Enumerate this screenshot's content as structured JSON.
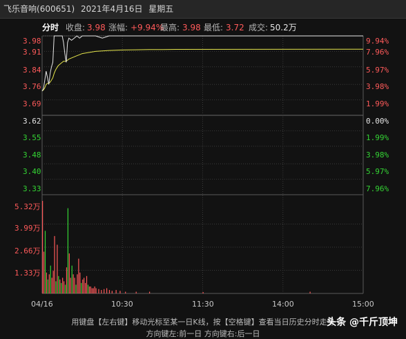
{
  "title": {
    "name": "飞乐音响",
    "code": "(600651)",
    "date": "2021年4月16日",
    "weekday": "星期五"
  },
  "info": {
    "mode": "分时",
    "close_label": "收盘:",
    "close_value": "3.98",
    "change_label": "涨幅:",
    "change_value": "+9.94%",
    "high_label": "最高:",
    "high_value": "3.98",
    "low_label": "最低:",
    "low_value": "3.72",
    "volume_label": "成交:",
    "volume_value": "50.2万"
  },
  "price_axis": {
    "left": [
      "3.98",
      "3.91",
      "3.84",
      "3.76",
      "3.69",
      "3.62",
      "3.55",
      "3.48",
      "3.40",
      "3.33"
    ],
    "right": [
      "9.94%",
      "7.96%",
      "5.97%",
      "3.98%",
      "1.99%",
      "0.00%",
      "1.99%",
      "3.98%",
      "5.97%",
      "7.96%"
    ]
  },
  "volume_axis": {
    "labels": [
      "5.32万",
      "3.99万",
      "2.66万",
      "1.33万"
    ]
  },
  "time_axis": [
    "04/16",
    "10:30",
    "11:30",
    "14:00",
    "15:00"
  ],
  "footer": {
    "line1": "用键盘【左右键】移动光标至某一日K线，按【空格键】查看当日历史分时走势",
    "line2": "方向键左:前一日   方向键右:后一日"
  },
  "watermark": "头条 @千斤顶坤",
  "colors": {
    "up": "#ff5a5a",
    "down": "#34d534",
    "price_line": "#e8e8e8",
    "avg_line": "#e6e64c",
    "grid": "#3a3a3a"
  },
  "chart_data": {
    "type": "line",
    "prev_close": 3.62,
    "ylim": [
      3.26,
      3.98
    ],
    "x": [
      0,
      1,
      2,
      3,
      4,
      5,
      6,
      7,
      8,
      9,
      10,
      11,
      12,
      13,
      14,
      15,
      16,
      17,
      18,
      19,
      20,
      22,
      24,
      26,
      28,
      30,
      35,
      40,
      45,
      50,
      60,
      70,
      80,
      90,
      100,
      240
    ],
    "series": [
      {
        "values": [
          3.73,
          3.74,
          3.78,
          3.82,
          3.79,
          3.76,
          3.81,
          3.84,
          3.86,
          3.98,
          3.98,
          3.98,
          3.98,
          3.98,
          3.98,
          3.98,
          3.95,
          3.9,
          3.86,
          3.95,
          3.97,
          3.96,
          3.97,
          3.98,
          3.97,
          3.98,
          3.98,
          3.98,
          3.97,
          3.98,
          3.98,
          3.98,
          3.98,
          3.98,
          3.98,
          3.98
        ]
      },
      {
        "values": [
          3.73,
          3.735,
          3.745,
          3.76,
          3.765,
          3.765,
          3.77,
          3.78,
          3.79,
          3.81,
          3.825,
          3.835,
          3.845,
          3.85,
          3.855,
          3.86,
          3.865,
          3.865,
          3.865,
          3.87,
          3.875,
          3.88,
          3.885,
          3.89,
          3.895,
          3.9,
          3.905,
          3.91,
          3.912,
          3.914,
          3.916,
          3.917,
          3.918,
          3.918,
          3.919,
          3.92
        ]
      }
    ],
    "volume": {
      "ylim": [
        0,
        5.32
      ],
      "bars": [
        [
          0,
          5.32,
          "up"
        ],
        [
          1,
          2.4,
          "up"
        ],
        [
          2,
          3.6,
          "down"
        ],
        [
          3,
          1.2,
          "up"
        ],
        [
          4,
          0.8,
          "down"
        ],
        [
          5,
          1.1,
          "up"
        ],
        [
          6,
          1.6,
          "down"
        ],
        [
          7,
          0.9,
          "up"
        ],
        [
          8,
          1.3,
          "up"
        ],
        [
          9,
          3.3,
          "up"
        ],
        [
          10,
          0.7,
          "down"
        ],
        [
          11,
          2.8,
          "up"
        ],
        [
          12,
          1.0,
          "down"
        ],
        [
          13,
          0.8,
          "up"
        ],
        [
          14,
          0.6,
          "down"
        ],
        [
          15,
          0.9,
          "up"
        ],
        [
          16,
          0.7,
          "up"
        ],
        [
          17,
          0.5,
          "down"
        ],
        [
          18,
          1.5,
          "up"
        ],
        [
          19,
          4.9,
          "down"
        ],
        [
          20,
          2.3,
          "up"
        ],
        [
          21,
          0.9,
          "up"
        ],
        [
          22,
          1.6,
          "down"
        ],
        [
          23,
          1.1,
          "up"
        ],
        [
          24,
          0.9,
          "up"
        ],
        [
          25,
          0.5,
          "down"
        ],
        [
          26,
          1.1,
          "up"
        ],
        [
          27,
          2.0,
          "up"
        ],
        [
          28,
          1.2,
          "up"
        ],
        [
          29,
          0.6,
          "down"
        ],
        [
          30,
          0.8,
          "up"
        ],
        [
          31,
          0.9,
          "up"
        ],
        [
          32,
          0.6,
          "up"
        ],
        [
          33,
          1.0,
          "up"
        ],
        [
          34,
          0.5,
          "down"
        ],
        [
          35,
          0.4,
          "up"
        ],
        [
          36,
          0.4,
          "up"
        ],
        [
          37,
          0.3,
          "up"
        ],
        [
          38,
          0.3,
          "up"
        ],
        [
          39,
          0.4,
          "up"
        ],
        [
          40,
          0.3,
          "up"
        ],
        [
          42,
          0.25,
          "up"
        ],
        [
          44,
          0.2,
          "up"
        ],
        [
          46,
          0.25,
          "up"
        ],
        [
          48,
          0.3,
          "up"
        ],
        [
          50,
          0.2,
          "up"
        ],
        [
          52,
          0.15,
          "up"
        ],
        [
          55,
          0.2,
          "up"
        ],
        [
          58,
          0.15,
          "up"
        ],
        [
          62,
          0.1,
          "up"
        ],
        [
          70,
          0.1,
          "up"
        ],
        [
          80,
          0.1,
          "up"
        ],
        [
          120,
          0.08,
          "up"
        ],
        [
          200,
          0.1,
          "up"
        ]
      ]
    }
  }
}
